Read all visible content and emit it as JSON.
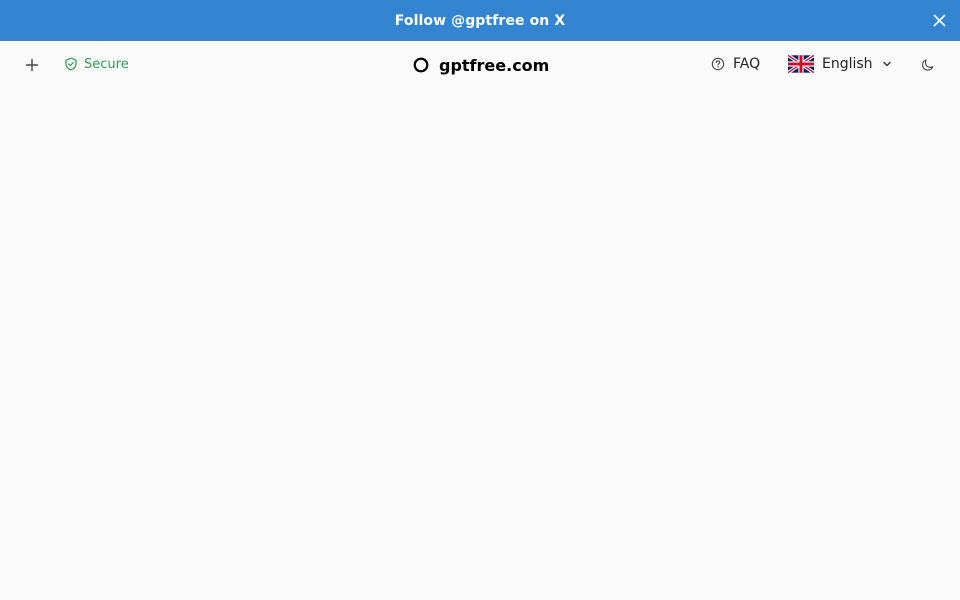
{
  "banner": {
    "text": "Follow @gptfree on X",
    "background": "#3384d1",
    "close_icon": "close-icon"
  },
  "header": {
    "new_chat_icon": "plus-icon",
    "secure": {
      "label": "Secure",
      "icon": "shield-check-icon",
      "color": "#2f9a57"
    },
    "brand": {
      "title": "gptfree.com",
      "icon": "circle-logo-icon"
    },
    "faq": {
      "label": "FAQ",
      "icon": "help-circle-icon"
    },
    "language": {
      "selected": "English",
      "flag_icon": "uk-flag-icon",
      "chevron_icon": "chevron-down-icon"
    },
    "theme_icon": "moon-icon"
  }
}
